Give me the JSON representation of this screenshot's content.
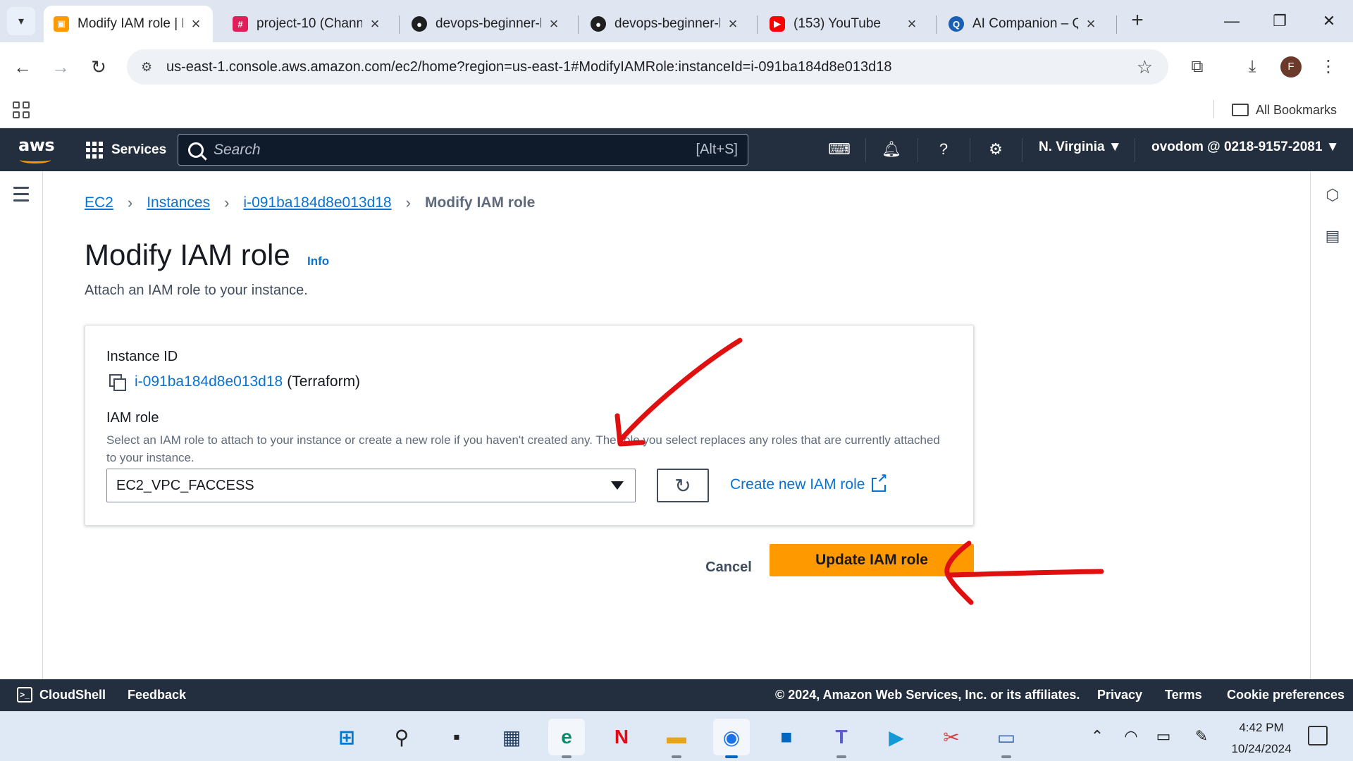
{
  "browser": {
    "tabs": [
      {
        "title": "Modify IAM role | E",
        "icon": "aws-favicon",
        "color": "#ff9900"
      },
      {
        "title": "project-10 (Channe",
        "icon": "slack-favicon",
        "color": "#e01e5a"
      },
      {
        "title": "devops-beginner-l",
        "icon": "github-favicon",
        "color": "#1f1f1f"
      },
      {
        "title": "devops-beginner-l",
        "icon": "github-favicon",
        "color": "#1f1f1f"
      },
      {
        "title": "(153) YouTube",
        "icon": "youtube-favicon",
        "color": "#ff0000"
      },
      {
        "title": "AI Companion – Q",
        "icon": "ai-companion-favicon",
        "color": "#1a5fb4"
      }
    ],
    "new_tab": "+",
    "url": "us-east-1.console.aws.amazon.com/ec2/home?region=us-east-1#ModifyIAMRole:instanceId=i-091ba184d8e013d18",
    "profile_initial": "F",
    "bookmarks_label": "All Bookmarks"
  },
  "aws_nav": {
    "logo_text": "aws",
    "services_label": "Services",
    "search_placeholder": "Search",
    "search_shortcut": "[Alt+S]",
    "region": "N. Virginia ▼",
    "account": "ovodom @ 0218-9157-2081 ▼"
  },
  "breadcrumb": {
    "items": [
      "EC2",
      "Instances",
      "i-091ba184d8e013d18"
    ],
    "current": "Modify IAM role"
  },
  "page": {
    "title": "Modify IAM role",
    "info_label": "Info",
    "description": "Attach an IAM role to your instance."
  },
  "form": {
    "instance_id_label": "Instance ID",
    "instance_id": "i-091ba184d8e013d18",
    "instance_name": "(Terraform)",
    "iam_role_label": "IAM role",
    "iam_role_description": "Select an IAM role to attach to your instance or create a new role if you haven't created any. The role you select replaces any roles that are currently attached to your instance.",
    "selected_role": "EC2_VPC_FACCESS",
    "create_role_label": "Create new IAM role"
  },
  "actions": {
    "cancel_label": "Cancel",
    "update_label": "Update IAM role"
  },
  "footer": {
    "cloudshell_label": "CloudShell",
    "feedback_label": "Feedback",
    "copyright": "© 2024, Amazon Web Services, Inc. or its affiliates.",
    "privacy": "Privacy",
    "terms": "Terms",
    "cookies": "Cookie preferences"
  },
  "taskbar": {
    "time": "4:42 PM",
    "date": "10/24/2024"
  },
  "colors": {
    "aws_nav_bg": "#232f3e",
    "link_blue": "#0972d3",
    "primary_orange": "#ff9900",
    "annotation_red": "#e01010"
  }
}
